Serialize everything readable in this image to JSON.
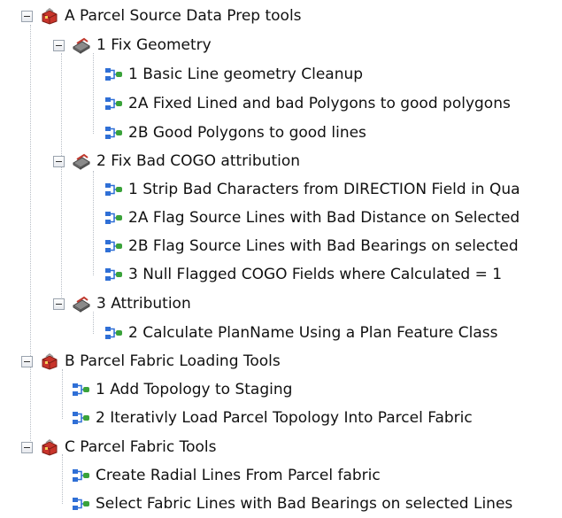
{
  "tree": {
    "groups": [
      {
        "label": "A Parcel Source Data Prep tools",
        "subgroups": [
          {
            "label": "1 Fix Geometry",
            "tools": [
              "1 Basic Line geometry Cleanup",
              "2A Fixed Lined and bad Polygons to good polygons",
              "2B Good Polygons to good lines"
            ]
          },
          {
            "label": "2 Fix Bad COGO attribution",
            "tools": [
              "1 Strip Bad Characters from DIRECTION Field in Qua",
              "2A Flag Source Lines with Bad Distance on Selected",
              "2B Flag Source Lines with Bad Bearings on selected",
              "3 Null Flagged COGO Fields where Calculated = 1"
            ]
          },
          {
            "label": "3 Attribution",
            "tools": [
              "2 Calculate PlanName Using a Plan Feature Class"
            ]
          }
        ]
      },
      {
        "label": "B Parcel Fabric Loading Tools",
        "tools": [
          "1 Add Topology to Staging",
          "2 Iterativly Load Parcel Topology Into Parcel Fabric"
        ]
      },
      {
        "label": "C Parcel Fabric Tools",
        "tools": [
          "Create Radial Lines From Parcel fabric",
          "Select Fabric Lines with Bad Bearings on selected Lines"
        ]
      }
    ]
  },
  "icons": {
    "toolbox": "red-toolbox-icon",
    "toolset": "gray-toolset-icon",
    "model": "model-tool-icon"
  },
  "colors": {
    "toolbox_red": "#c8342b",
    "toolset_gray": "#6f6f6f",
    "model_blue": "#2f6fd6",
    "model_green": "#3aa23a"
  }
}
